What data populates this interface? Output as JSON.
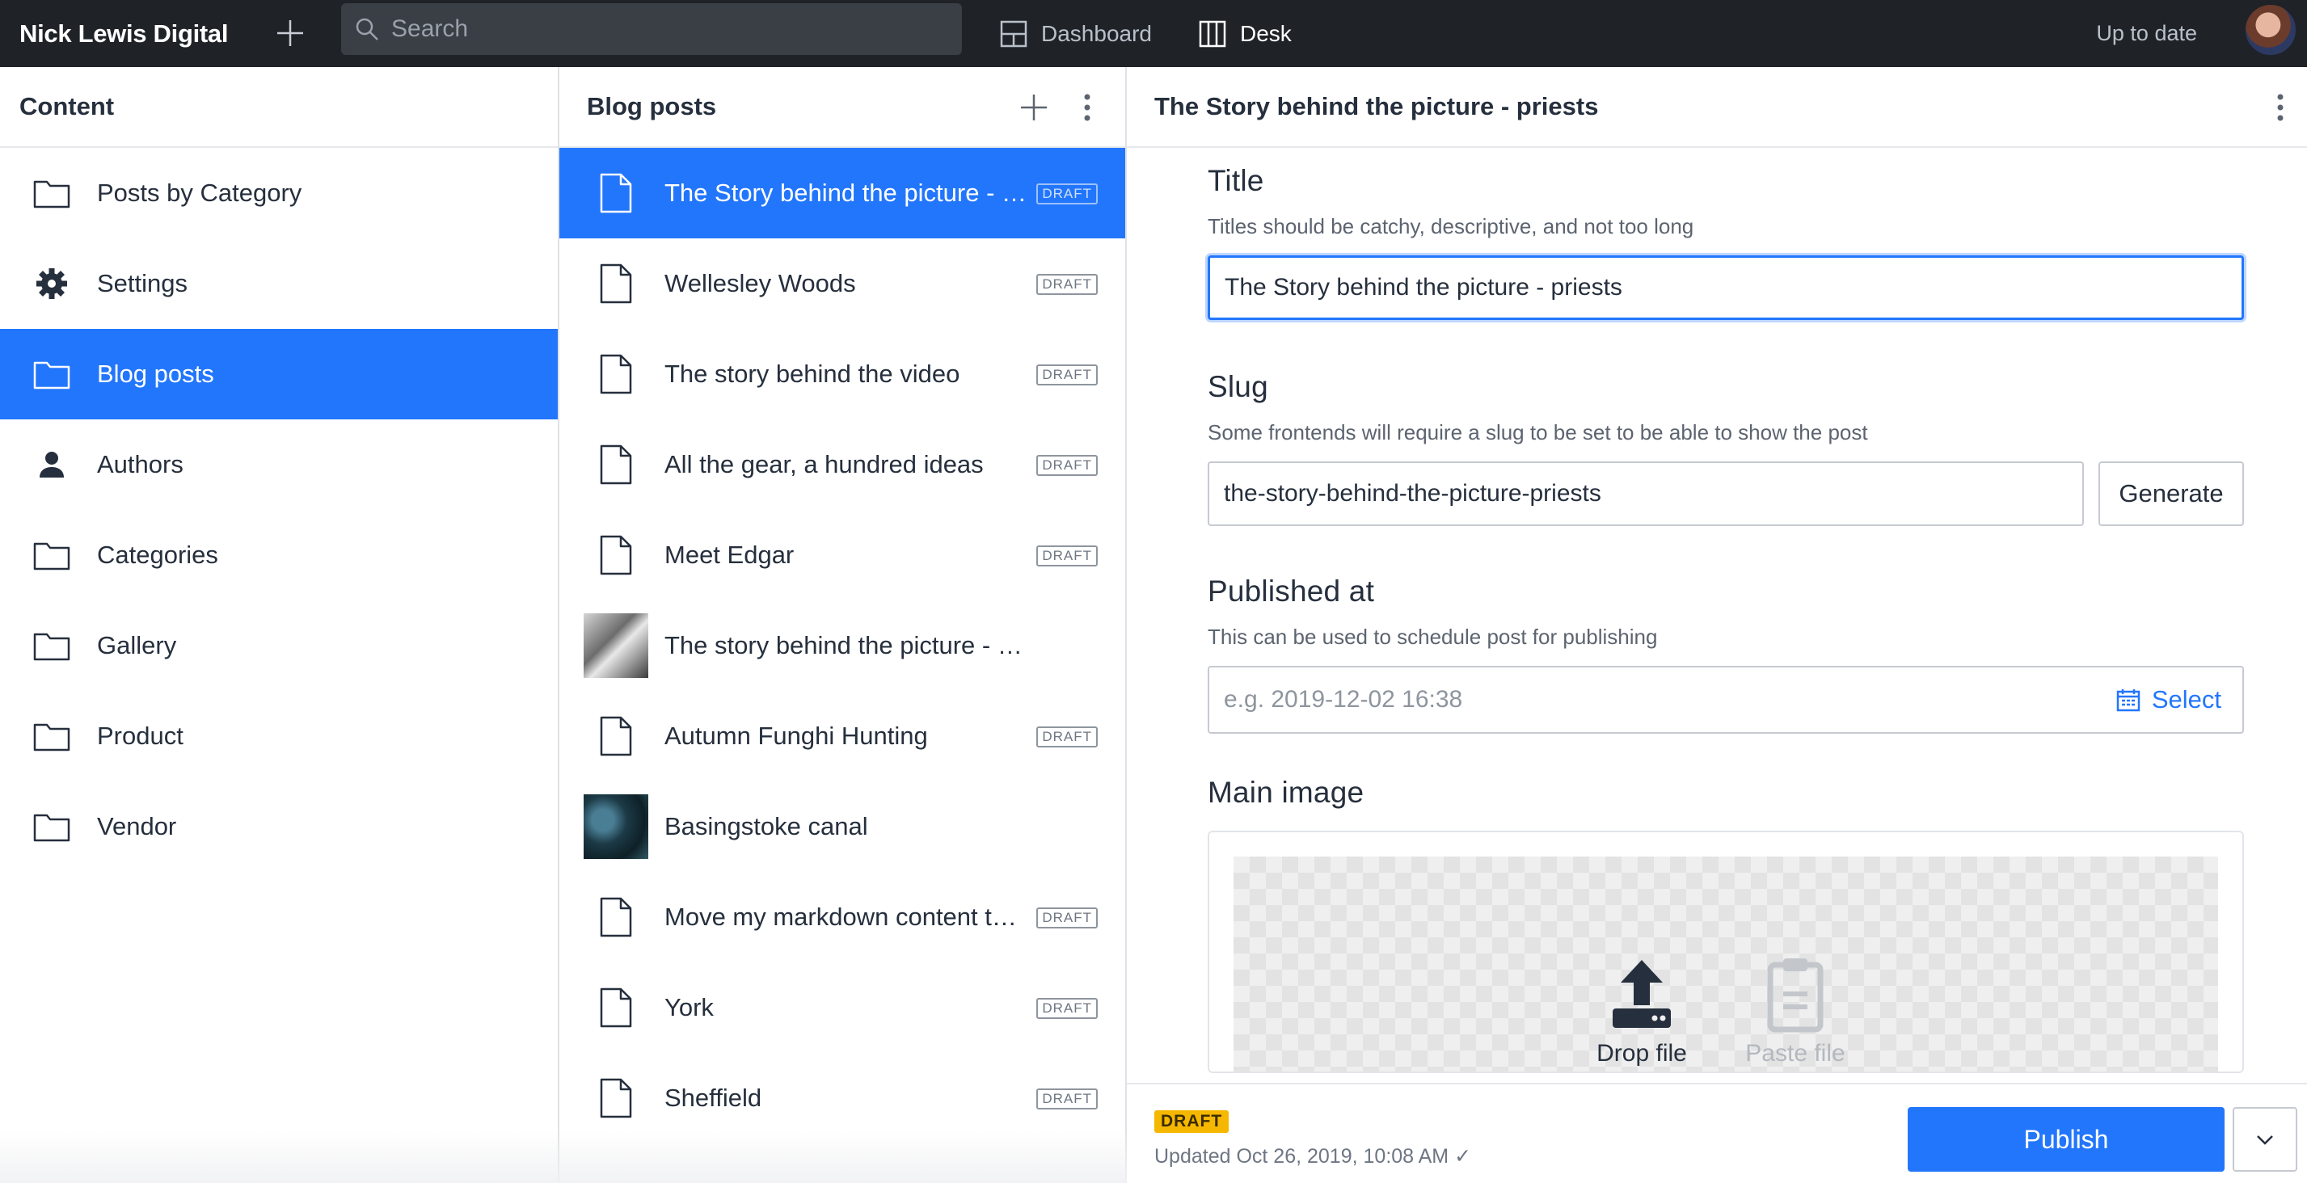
{
  "navbar": {
    "brand": "Nick Lewis Digital",
    "search_placeholder": "Search",
    "tools": [
      {
        "label": "Dashboard",
        "icon": "dashboard-icon"
      },
      {
        "label": "Desk",
        "icon": "desk-icon"
      }
    ],
    "status": "Up to date"
  },
  "content_pane": {
    "title": "Content",
    "items": [
      {
        "label": "Posts by Category",
        "icon": "folder-icon"
      },
      {
        "label": "Settings",
        "icon": "gear-icon"
      },
      {
        "label": "Blog posts",
        "icon": "folder-icon"
      },
      {
        "label": "Authors",
        "icon": "person-icon"
      },
      {
        "label": "Categories",
        "icon": "folder-icon"
      },
      {
        "label": "Gallery",
        "icon": "folder-icon"
      },
      {
        "label": "Product",
        "icon": "folder-icon"
      },
      {
        "label": "Vendor",
        "icon": "folder-icon"
      }
    ]
  },
  "posts_pane": {
    "title": "Blog posts",
    "items": [
      {
        "label": "The Story behind the picture - priests",
        "badge": "DRAFT"
      },
      {
        "label": "Wellesley Woods",
        "badge": "DRAFT"
      },
      {
        "label": "The story behind the video",
        "badge": "DRAFT"
      },
      {
        "label": "All the gear, a hundred ideas",
        "badge": "DRAFT"
      },
      {
        "label": "Meet Edgar",
        "badge": "DRAFT"
      },
      {
        "label": "The story behind the picture - Bride and groom",
        "badge": ""
      },
      {
        "label": "Autumn Funghi Hunting",
        "badge": "DRAFT"
      },
      {
        "label": "Basingstoke canal",
        "badge": ""
      },
      {
        "label": "Move my markdown content to Sanity",
        "badge": "DRAFT"
      },
      {
        "label": "York",
        "badge": "DRAFT"
      },
      {
        "label": "Sheffield",
        "badge": "DRAFT"
      }
    ]
  },
  "editor": {
    "title": "The Story behind the picture - priests",
    "fields": {
      "title": {
        "label": "Title",
        "description": "Titles should be catchy, descriptive, and not too long",
        "value": "The Story behind the picture - priests"
      },
      "slug": {
        "label": "Slug",
        "description": "Some frontends will require a slug to be set to be able to show the post",
        "value": "the-story-behind-the-picture-priests",
        "button": "Generate"
      },
      "published_at": {
        "label": "Published at",
        "description": "This can be used to schedule post for publishing",
        "placeholder": "e.g. 2019-12-02 16:38",
        "button": "Select"
      },
      "main_image": {
        "label": "Main image",
        "drop_label": "Drop file",
        "paste_label": "Paste file"
      }
    }
  },
  "footer": {
    "status_badge": "DRAFT",
    "updated": "Updated Oct 26, 2019, 10:08 AM ✓",
    "publish_label": "Publish"
  },
  "colors": {
    "accent": "#2276fc",
    "navbar": "#1f2328",
    "draft_badge": "#f5b700"
  }
}
